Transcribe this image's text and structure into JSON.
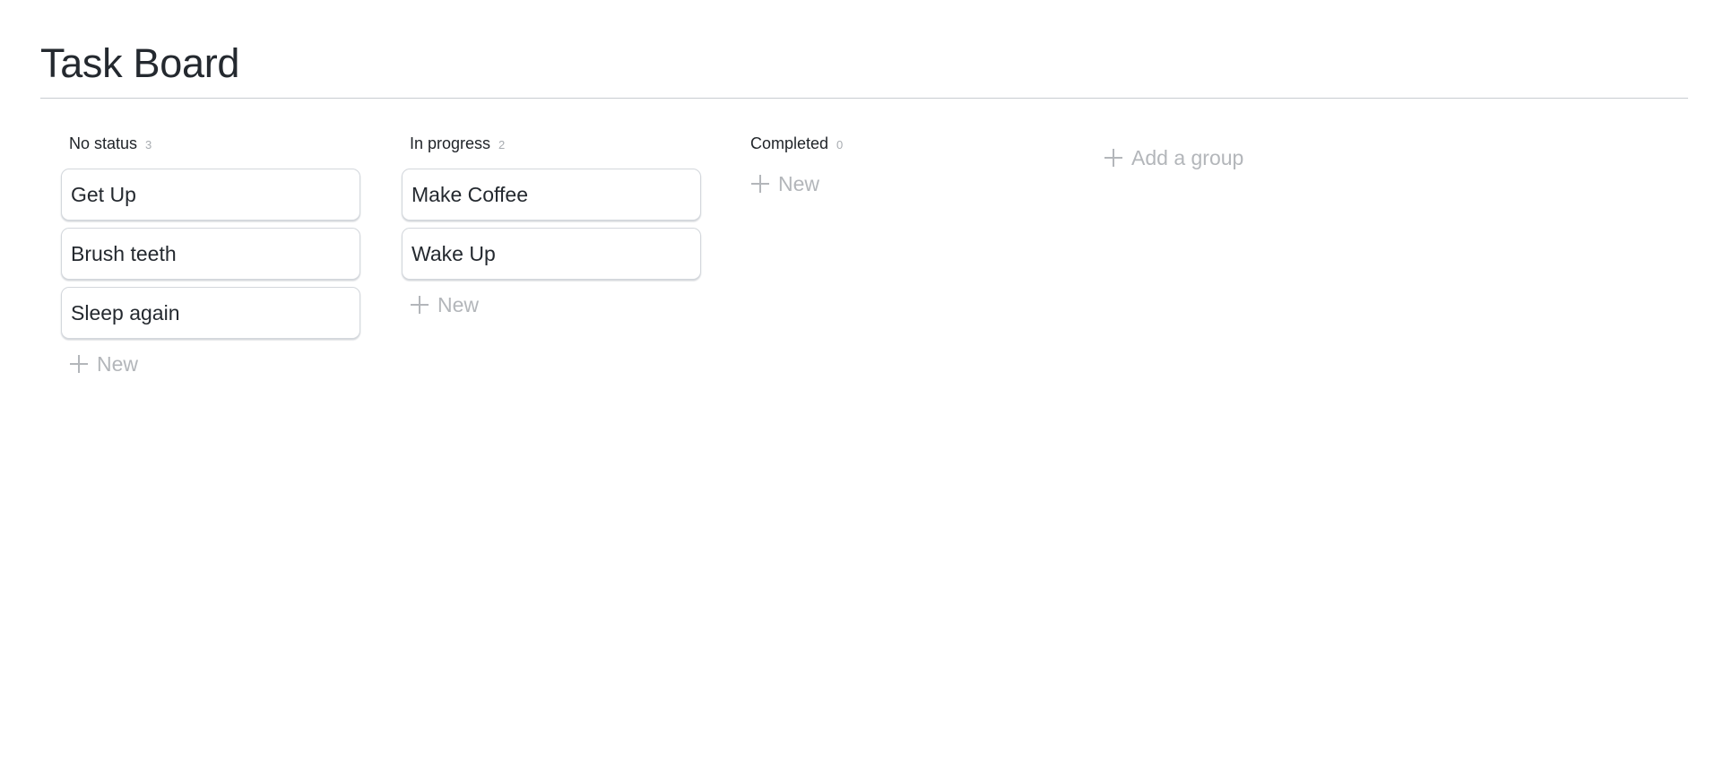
{
  "page": {
    "title": "Task Board"
  },
  "board": {
    "columns": [
      {
        "title": "No status",
        "count": "3",
        "cards": [
          "Get Up",
          "Brush teeth",
          "Sleep again"
        ],
        "new_label": "New"
      },
      {
        "title": "In progress",
        "count": "2",
        "cards": [
          "Make Coffee",
          "Wake Up"
        ],
        "new_label": "New"
      },
      {
        "title": "Completed",
        "count": "0",
        "cards": [],
        "new_label": "New"
      }
    ],
    "add_group_label": "Add a group"
  },
  "icons": {
    "new": "plus-icon",
    "add_group": "plus-icon"
  },
  "colors": {
    "text": "#24292f",
    "muted": "#b3b6ba",
    "count": "#a8acb1",
    "card_border": "#d3d7dc",
    "rule": "#c8ccd1"
  }
}
